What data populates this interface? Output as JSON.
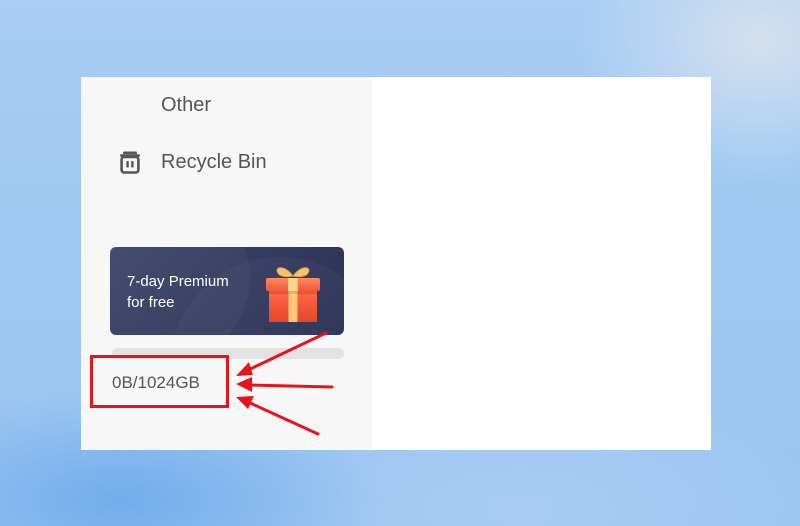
{
  "sidebar": {
    "items": [
      {
        "label": "Other",
        "icon": "folder-other"
      },
      {
        "label": "Recycle Bin",
        "icon": "trash-icon"
      }
    ]
  },
  "promo": {
    "line1": "7-day Premium",
    "line2": "for free",
    "icon": "gift-icon"
  },
  "storage": {
    "text": "0B/1024GB",
    "used_fraction": 0
  },
  "annotation": {
    "color": "#e8141b"
  }
}
